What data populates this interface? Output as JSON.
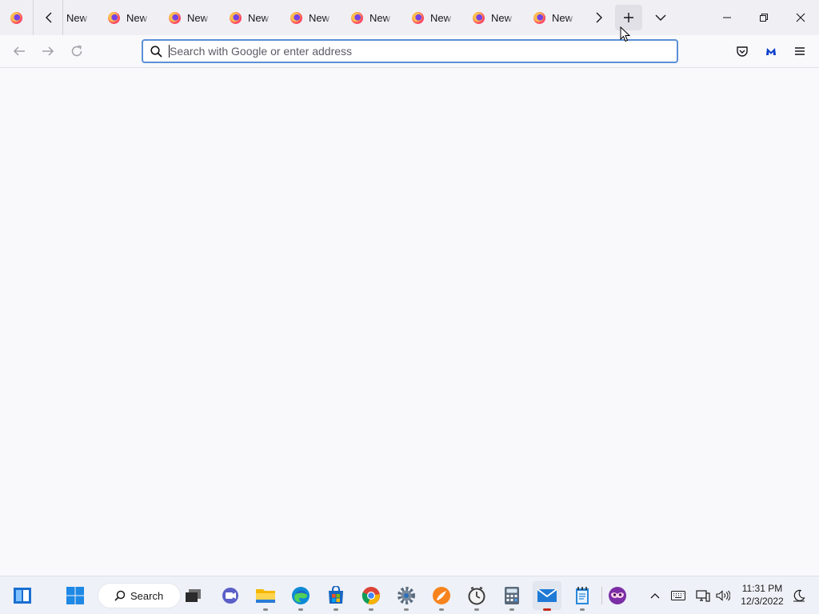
{
  "browser": {
    "tabs": [
      {
        "title": "New Tab"
      },
      {
        "title": "New Tab"
      },
      {
        "title": "New Tab"
      },
      {
        "title": "New Tab"
      },
      {
        "title": "New Tab"
      },
      {
        "title": "New Tab"
      },
      {
        "title": "New Tab"
      },
      {
        "title": "New Tab"
      },
      {
        "title": "New Tab"
      }
    ],
    "urlbar": {
      "placeholder": "Search with Google or enter address",
      "value": ""
    }
  },
  "taskbar": {
    "search_label": "Search",
    "apps": [
      "widgets",
      "start",
      "search",
      "task-view",
      "teams-chat",
      "file-explorer",
      "edge",
      "microsoft-store",
      "chrome",
      "settings",
      "app-launcher",
      "clock-app",
      "calculator",
      "mail",
      "notepad",
      "game-app"
    ],
    "clock": {
      "time": "11:31 PM",
      "date": "12/3/2022"
    }
  },
  "colors": {
    "tabbar_bg": "#f0f0f4",
    "toolbar_bg": "#f9f9fb",
    "urlbar_focus": "#5b8fd6",
    "taskbar_bg": "#eef1f7",
    "active_indicator": "#c42b1c"
  }
}
